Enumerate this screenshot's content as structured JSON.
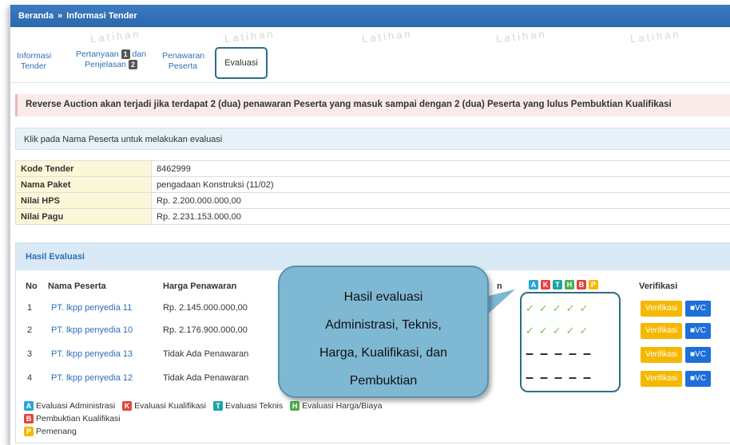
{
  "breadcrumb": {
    "home": "Beranda",
    "sep": "»",
    "current": "Informasi Tender"
  },
  "watermark": "Latihan",
  "tabs": [
    {
      "line1": "Informasi",
      "line2": "Tender"
    },
    {
      "line1": "Pertanyaan",
      "badge": "1",
      "line1b": "dan",
      "line2": "Penjelasan",
      "badge2": "2"
    },
    {
      "line1": "Penawaran",
      "line2": "Peserta"
    },
    {
      "label": "Evaluasi"
    }
  ],
  "alert": "Reverse Auction akan terjadi jika terdapat 2 (dua) penawaran Peserta yang masuk sampai dengan 2 (dua) Peserta yang lulus Pembuktian Kualifikasi",
  "info": "Klik pada Nama Peserta untuk melakukan evaluasi",
  "details": [
    {
      "key": "Kode Tender",
      "value": "8462999"
    },
    {
      "key": "Nama Paket",
      "value": "pengadaan Konstruksi (11/02)"
    },
    {
      "key": "Nilai HPS",
      "value": "Rp. 2.200.000.000,00"
    },
    {
      "key": "Nilai Pagu",
      "value": "Rp. 2.231.153.000,00"
    }
  ],
  "panel": {
    "title": "Hasil Evaluasi",
    "headers": {
      "no": "No",
      "name": "Nama Peserta",
      "price": "Harga Penawaran",
      "partial": "n",
      "verifikasi": "Verifikasi"
    },
    "stage_badges": [
      {
        "letter": "A",
        "color": "#2aa6d6"
      },
      {
        "letter": "K",
        "color": "#e0453c"
      },
      {
        "letter": "T",
        "color": "#21a3a3"
      },
      {
        "letter": "H",
        "color": "#4caf50"
      },
      {
        "letter": "B",
        "color": "#e0453c"
      },
      {
        "letter": "P",
        "color": "#f5b800"
      }
    ],
    "rows": [
      {
        "no": "1",
        "name": "PT. lkpp penyedia 11",
        "price": "Rp. 2.145.000.000,00",
        "status": "✓✓✓✓✓"
      },
      {
        "no": "2",
        "name": "PT. lkpp penyedia 10",
        "price": "Rp. 2.176.900.000,00",
        "status": "✓✓✓✓✓"
      },
      {
        "no": "3",
        "name": "PT. lkpp penyedia 13",
        "price": "Tidak Ada Penawaran",
        "status": "–––––"
      },
      {
        "no": "4",
        "name": "PT. lkpp penyedia 12",
        "price": "Tidak Ada Penawaran",
        "status": "–––––"
      }
    ],
    "buttons": {
      "verifikasi": "Verifikasi",
      "vc": "VC"
    },
    "legend": [
      {
        "letter": "A",
        "color": "#2aa6d6",
        "text": "Evaluasi Administrasi"
      },
      {
        "letter": "K",
        "color": "#e0453c",
        "text": "Evaluasi Kualifikasi"
      },
      {
        "letter": "T",
        "color": "#21a3a3",
        "text": "Evaluasi Teknis"
      },
      {
        "letter": "H",
        "color": "#4caf50",
        "text": "Evaluasi Harga/Biaya"
      },
      {
        "letter": "B",
        "color": "#e0453c",
        "text": "Pembuktian Kualifikasi"
      },
      {
        "letter": "P",
        "color": "#f5b800",
        "text": "Pemenang"
      }
    ]
  },
  "callout": {
    "lines": [
      "Hasil evaluasi",
      "Administrasi, Teknis,",
      "Harga, Kualifikasi, dan",
      "Pembuktian"
    ]
  }
}
